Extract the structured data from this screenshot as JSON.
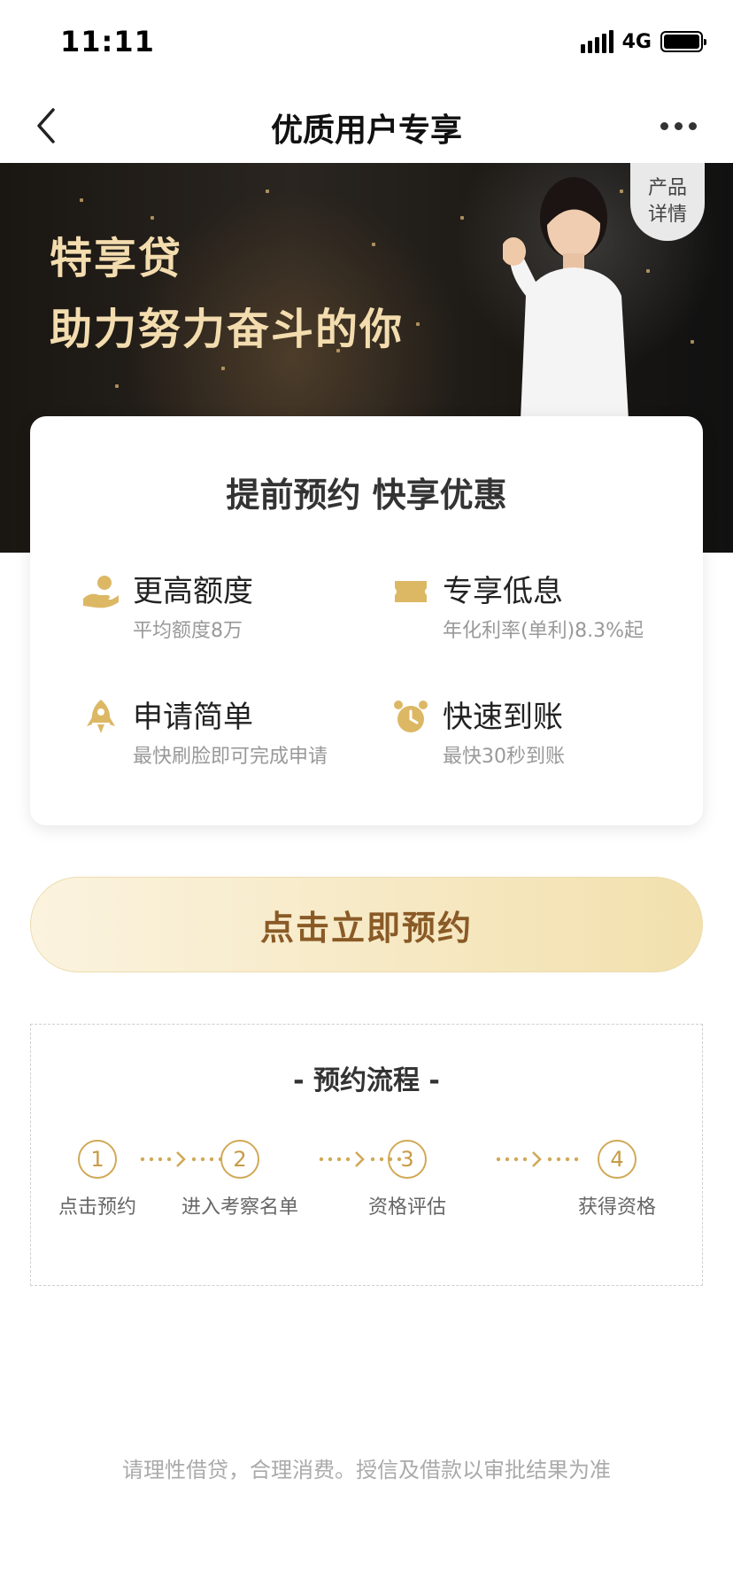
{
  "status_bar": {
    "time": "11:11",
    "network": "4G"
  },
  "nav": {
    "title": "优质用户专享",
    "back_icon": "chevron-left-icon",
    "more_icon": "more-dots-icon"
  },
  "hero": {
    "line1": "特享贷",
    "line2": "助力努力奋斗的你",
    "detail_badge": {
      "line1": "产品",
      "line2": "详情"
    }
  },
  "card": {
    "title": "提前预约 快享优惠",
    "features": [
      {
        "icon": "hand-coin-icon",
        "title": "更高额度",
        "desc": "平均额度8万"
      },
      {
        "icon": "ticket-icon",
        "title": "专享低息",
        "desc": "年化利率(单利)8.3%起"
      },
      {
        "icon": "rocket-icon",
        "title": "申请简单",
        "desc": "最快刷脸即可完成申请"
      },
      {
        "icon": "alarm-clock-icon",
        "title": "快速到账",
        "desc": "最快30秒到账"
      }
    ]
  },
  "cta": {
    "label": "点击立即预约"
  },
  "process": {
    "title": "- 预约流程 -",
    "steps": [
      {
        "num": "1",
        "label": "点击预约"
      },
      {
        "num": "2",
        "label": "进入考察名单"
      },
      {
        "num": "3",
        "label": "资格评估"
      },
      {
        "num": "4",
        "label": "获得资格"
      }
    ]
  },
  "footer": {
    "text": "请理性借贷，合理消费。授信及借款以审批结果为准"
  },
  "colors": {
    "gold": "#d0a956",
    "cta_text": "#8a5a26",
    "hero_text": "#f3dcae"
  }
}
